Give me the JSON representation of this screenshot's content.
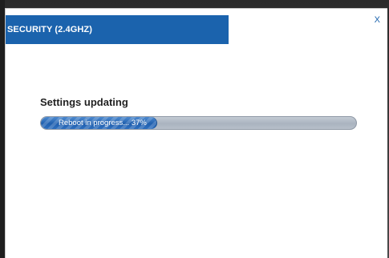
{
  "dialog": {
    "title": "SECURITY (2.4GHZ)",
    "close_label": "X"
  },
  "status": {
    "heading": "Settings updating",
    "progress_text": "Reboot in progress... 37%",
    "progress_percent": 37
  },
  "colors": {
    "header_bg": "#1b63ad",
    "progress_fill": "#1f5fae",
    "progress_track": "#a9b3bf"
  }
}
